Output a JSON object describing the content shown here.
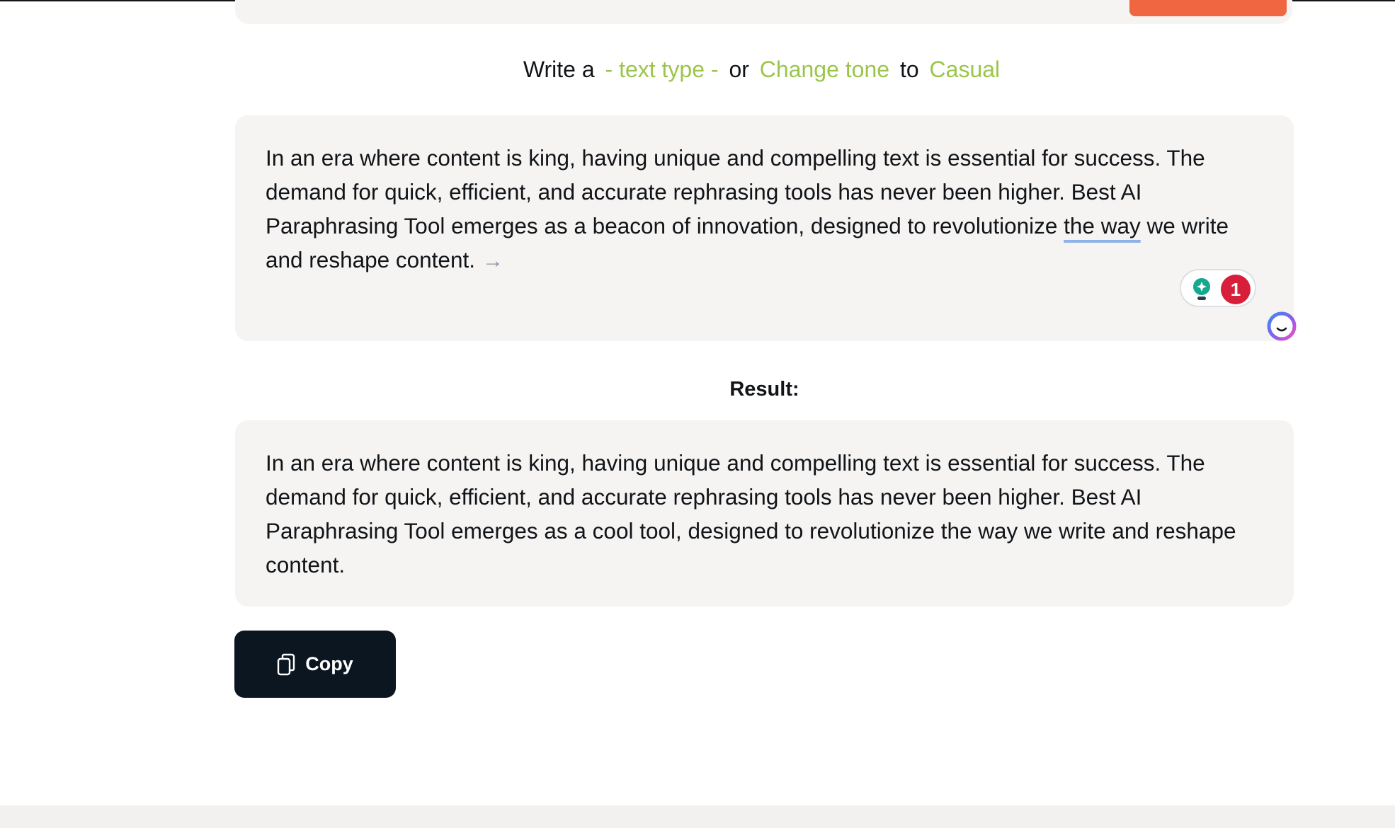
{
  "prompt": {
    "write_a": "Write a",
    "text_type": "- text type -",
    "or": "or",
    "change_tone": "Change tone",
    "to": "to",
    "tone": "Casual"
  },
  "input": {
    "text_before": "In an era where content is king, having unique and compelling text is essential for success. The demand for quick, efficient, and accurate rephrasing tools has never been higher. Best AI Paraphrasing Tool emerges as a beacon of innovation, designed to revolutionize ",
    "underlined": "the way",
    "text_after": " we write and reshape content.",
    "arrow_glyph": "→"
  },
  "assistant": {
    "suggestion_count": "1",
    "accent_colors": {
      "bulb": "#14a88f",
      "badge": "#d81f3a"
    }
  },
  "result": {
    "label": "Result:",
    "text": "In an era where content is king, having unique and compelling text is essential for success. The demand for quick, efficient, and accurate rephrasing tools has never been higher. Best AI Paraphrasing Tool emerges as a cool tool, designed to revolutionize the way we write and reshape content."
  },
  "actions": {
    "copy_label": "Copy"
  },
  "colors": {
    "accent_green": "#9bc54a",
    "card_bg": "#f5f4f2",
    "button_dark": "#0b1620",
    "orange": "#ef6640"
  }
}
